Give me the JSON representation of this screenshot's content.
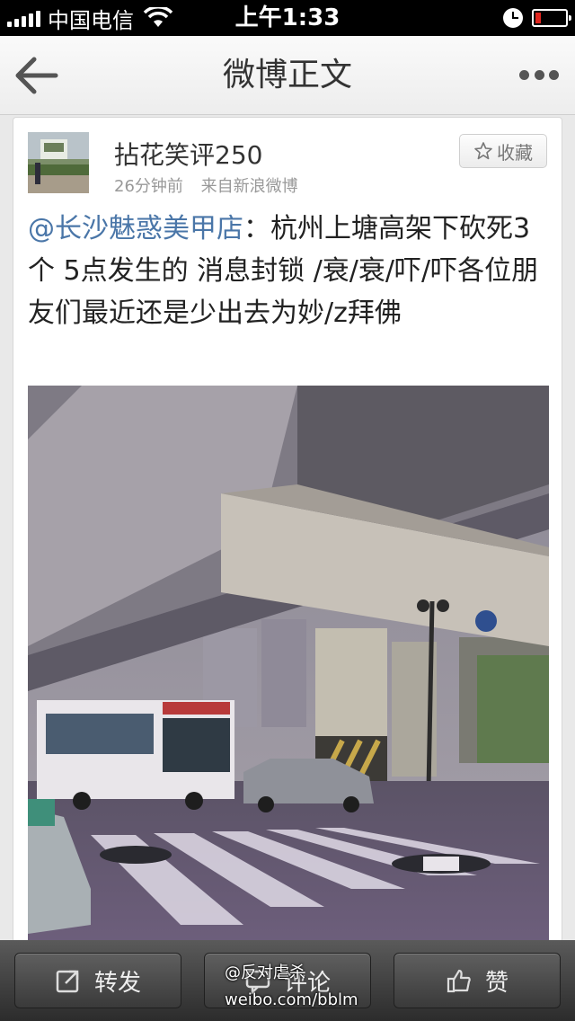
{
  "status_bar": {
    "carrier": "中国电信",
    "time": "上午1:33",
    "battery_level": 0.18,
    "icons": [
      "signal-icon",
      "wifi-icon",
      "clock-icon",
      "battery-icon"
    ]
  },
  "nav": {
    "title": "微博正文",
    "back_icon": "back-arrow-icon",
    "more_icon": "more-dots-icon"
  },
  "post": {
    "username": "拈花笑评250",
    "time_ago": "26分钟前",
    "source": "来自新浪微博",
    "favorite_label": "收藏",
    "mention": "@长沙魅惑美甲店",
    "text": "：杭州上塘高架下砍死3个 5点发生的 消息封锁 /衰/衰/吓/吓各位朋友们最近还是少出去为妙/z拜佛"
  },
  "toolbar": {
    "repost_label": "转发",
    "comment_label": "评论",
    "like_label": "赞"
  },
  "watermark": {
    "handle": "@反对虐杀",
    "site": "weibo.com/bblm"
  },
  "colors": {
    "mention": "#4a76a8",
    "background": "#e9e9e9",
    "toolbar": "#3a3a3a"
  }
}
